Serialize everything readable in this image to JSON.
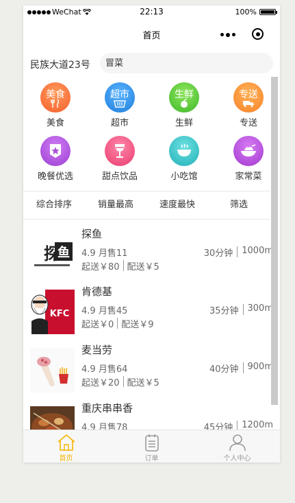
{
  "status_bar": {
    "carrier": "WeChat",
    "time": "22:13",
    "battery": "100%"
  },
  "nav": {
    "title": "首页"
  },
  "search": {
    "location": "民族大道23号",
    "value": "冒菜"
  },
  "categories": [
    {
      "label": "美食",
      "icon_text": "美食",
      "icon": "fork-spoon-icon",
      "color": "#f9683a"
    },
    {
      "label": "超市",
      "icon_text": "超市",
      "icon": "basket-icon",
      "color": "#2f93e8"
    },
    {
      "label": "生鲜",
      "icon_text": "生鲜",
      "icon": "fruit-icon",
      "color": "#4fc33b"
    },
    {
      "label": "专送",
      "icon_text": "专送",
      "icon": "delivery-icon",
      "color": "#fb8b33"
    },
    {
      "label": "晚餐优选",
      "icon_text": "",
      "icon": "star-badge-icon",
      "color": "#a84fd8"
    },
    {
      "label": "甜点饮品",
      "icon_text": "",
      "icon": "wine-glass-icon",
      "color": "#ef4f7f"
    },
    {
      "label": "小吃馆",
      "icon_text": "",
      "icon": "bowl-icon",
      "color": "#2fc1c6"
    },
    {
      "label": "家常菜",
      "icon_text": "",
      "icon": "dish-icon",
      "color": "#b247d6"
    }
  ],
  "sort": [
    "综合排序",
    "销量最高",
    "速度最快",
    "筛选"
  ],
  "shops": [
    {
      "name": "探鱼",
      "rating": "4.9",
      "sales": "月售11",
      "time": "30分钟",
      "distance": "1000m",
      "min_order": "起送￥80",
      "delivery_fee": "配送￥5",
      "logo": "tanyu-logo"
    },
    {
      "name": "肯德基",
      "rating": "4.9",
      "sales": "月售45",
      "time": "35分钟",
      "distance": "300m",
      "min_order": "起送￥0",
      "delivery_fee": "配送￥9",
      "logo": "kfc-logo"
    },
    {
      "name": "麦当劳",
      "rating": "4.9",
      "sales": "月售64",
      "time": "40分钟",
      "distance": "900m",
      "min_order": "起送￥20",
      "delivery_fee": "配送￥5",
      "logo": "mcdonalds-logo"
    },
    {
      "name": "重庆串串香",
      "rating": "4.9",
      "sales": "月售78",
      "time": "45分钟",
      "distance": "1200m",
      "min_order": "",
      "delivery_fee": "",
      "logo": "chuanchuan-logo"
    }
  ],
  "tabs": [
    {
      "label": "首页",
      "icon": "home-icon",
      "active": true
    },
    {
      "label": "订单",
      "icon": "order-icon",
      "active": false
    },
    {
      "label": "个人中心",
      "icon": "user-icon",
      "active": false
    }
  ],
  "colors": {
    "accent": "#f5b400",
    "kfc_red": "#c8102e"
  }
}
